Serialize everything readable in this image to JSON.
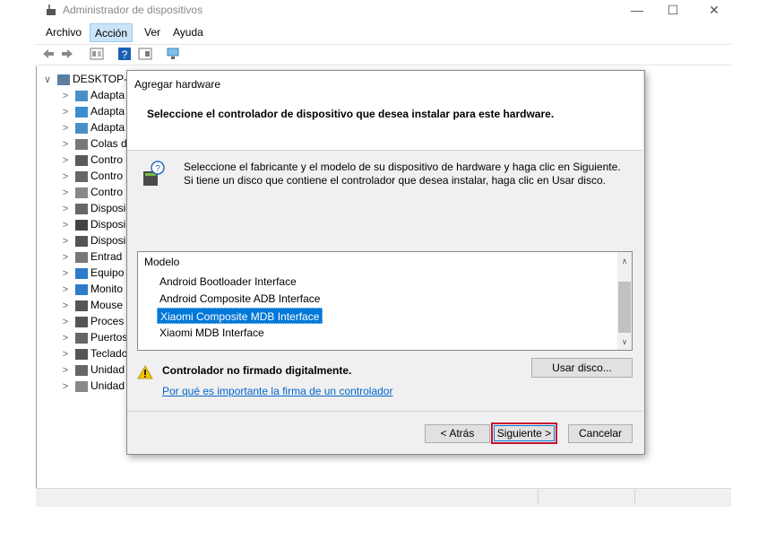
{
  "window": {
    "title": "Administrador de dispositivos",
    "minimize": "—",
    "maximize": "☐",
    "close": "✕"
  },
  "menu": [
    "Archivo",
    "Acción",
    "Ver",
    "Ayuda"
  ],
  "tree": {
    "root": "DESKTOP-I",
    "items": [
      "Adapta",
      "Adapta",
      "Adapta",
      "Colas d",
      "Contro",
      "Contro",
      "Contro",
      "Disposi",
      "Disposi",
      "Disposi",
      "Entrad",
      "Equipo",
      "Monito",
      "Mouse",
      "Proces",
      "Puertos",
      "Teclado",
      "Unidad",
      "Unidad"
    ]
  },
  "dialog": {
    "title": "Agregar hardware",
    "heading": "Seleccione el controlador de dispositivo que desea instalar para este hardware.",
    "description": "Seleccione el fabricante y el modelo de su dispositivo de hardware y haga clic en Siguiente. Si tiene un disco que contiene el controlador que desea instalar, haga clic en  Usar disco.",
    "list_header": "Modelo",
    "models": [
      "Android Bootloader Interface",
      "Android Composite ADB Interface",
      "Xiaomi Composite MDB Interface",
      "Xiaomi MDB Interface"
    ],
    "selected_index": 2,
    "warning": "Controlador no firmado digitalmente.",
    "link": "Por qué es importante la firma de un controlador",
    "use_disk": "Usar disco...",
    "back": "< Atrás",
    "next": "Siguiente >",
    "cancel": "Cancelar"
  },
  "colors": {
    "selection": "#0078d7",
    "link": "#0066cc",
    "highlight_border": "#c8102e"
  }
}
